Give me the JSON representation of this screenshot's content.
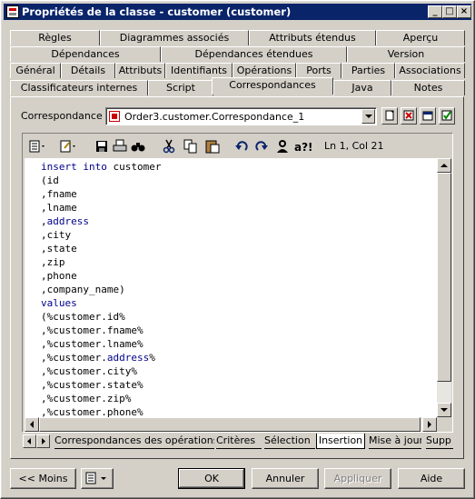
{
  "window": {
    "title": "Propriétés de la classe - customer (customer)"
  },
  "tabs": {
    "row1": [
      "Règles",
      "Diagrammes associés",
      "Attributs étendus",
      "Aperçu"
    ],
    "row2": [
      "Dépendances",
      "Dépendances étendues",
      "Version"
    ],
    "row3": [
      "Général",
      "Détails",
      "Attributs",
      "Identifiants",
      "Opérations",
      "Ports",
      "Parties",
      "Associations"
    ],
    "row4": [
      "Classificateurs internes",
      "Script",
      "Correspondances",
      "Java",
      "Notes"
    ],
    "active": "Correspondances"
  },
  "mapping": {
    "label": "Correspondance :",
    "value": "Order3.customer.Correspondance_1",
    "buttons": [
      "properties-icon",
      "delete-icon",
      "create-icon",
      "check-icon"
    ]
  },
  "editor": {
    "position": "Ln 1, Col 21",
    "lines": [
      [
        [
          "kw",
          "insert into"
        ],
        [
          "",
          " customer"
        ]
      ],
      [
        [
          "",
          "(id"
        ]
      ],
      [
        [
          "",
          ",fname"
        ]
      ],
      [
        [
          "",
          ",lname"
        ]
      ],
      [
        [
          "",
          ","
        ],
        [
          "kw",
          "address"
        ]
      ],
      [
        [
          "",
          ",city"
        ]
      ],
      [
        [
          "",
          ",state"
        ]
      ],
      [
        [
          "",
          ",zip"
        ]
      ],
      [
        [
          "",
          ",phone"
        ]
      ],
      [
        [
          "",
          ",company_name)"
        ]
      ],
      [
        [
          "kw",
          "values"
        ]
      ],
      [
        [
          "",
          "(%customer.id%"
        ]
      ],
      [
        [
          "",
          ",%customer.fname%"
        ]
      ],
      [
        [
          "",
          ",%customer.lname%"
        ]
      ],
      [
        [
          "",
          ",%customer."
        ],
        [
          "kw",
          "address"
        ],
        [
          "",
          "%"
        ]
      ],
      [
        [
          "",
          ",%customer.city%"
        ]
      ],
      [
        [
          "",
          ",%customer.state%"
        ]
      ],
      [
        [
          "",
          ",%customer.zip%"
        ]
      ],
      [
        [
          "",
          ",%customer.phone%"
        ]
      ]
    ]
  },
  "bottom_tabs": {
    "items": [
      "Correspondances des opérations",
      "Critères",
      "Sélection",
      "Insertion",
      "Mise à jour",
      "Supp"
    ],
    "active": "Insertion"
  },
  "footer": {
    "less": "<< Moins",
    "ok": "OK",
    "cancel": "Annuler",
    "apply": "Appliquer",
    "help": "Aide"
  }
}
